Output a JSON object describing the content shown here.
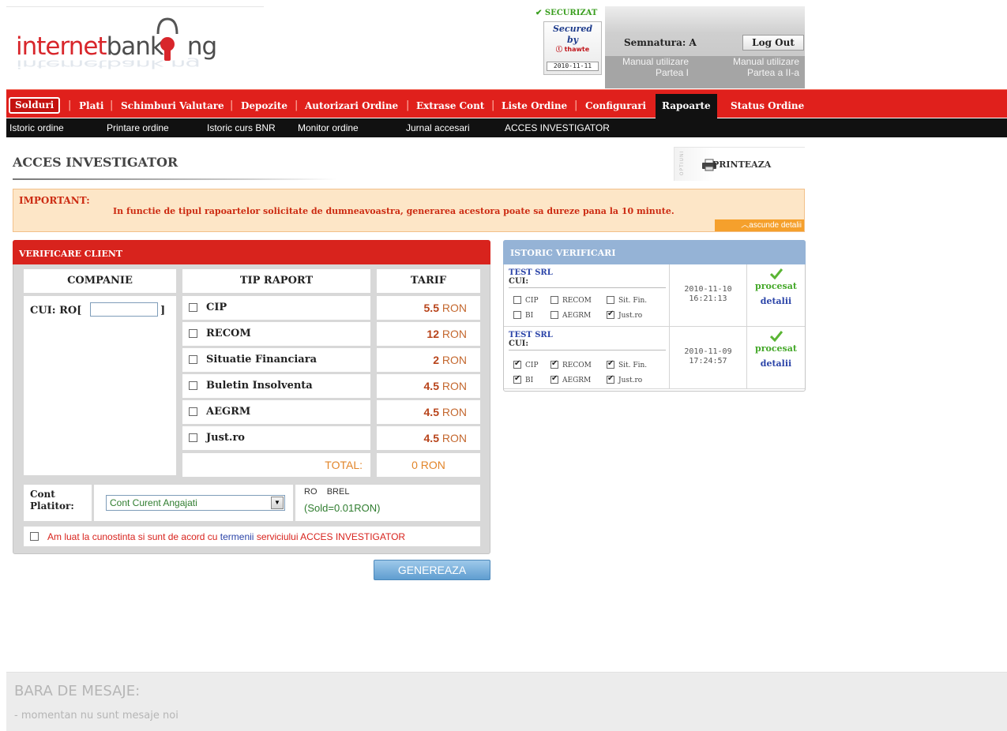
{
  "logo": {
    "word1": "internet",
    "word2": "bank",
    "word3": "ng"
  },
  "security": {
    "securizat": "SECURIZAT",
    "seal_line1": "Secured",
    "seal_line2": "by",
    "seal_brand": "thawte",
    "seal_date": "2010-11-11"
  },
  "user": {
    "semnatura": "Semnatura: A",
    "logout": "Log Out",
    "manual1_l1": "Manual utilizare",
    "manual1_l2": "Partea I",
    "manual2_l1": "Manual utilizare",
    "manual2_l2": "Partea a II-a"
  },
  "main_menu": [
    {
      "label": "Solduri"
    },
    {
      "label": "Plati"
    },
    {
      "label": "Schimburi Valutare"
    },
    {
      "label": "Depozite"
    },
    {
      "label": "Autorizari Ordine"
    },
    {
      "label": "Extrase Cont"
    },
    {
      "label": "Liste Ordine"
    },
    {
      "label": "Configurari"
    },
    {
      "label": "Rapoarte"
    },
    {
      "label": "Status Ordine"
    }
  ],
  "sub_menu": [
    {
      "label": "Istoric ordine"
    },
    {
      "label": "Printare ordine"
    },
    {
      "label": "Istoric curs BNR"
    },
    {
      "label": "Monitor ordine"
    },
    {
      "label": "Jurnal accesari"
    },
    {
      "label": "ACCES INVESTIGATOR"
    }
  ],
  "page": {
    "title": "ACCES INVESTIGATOR",
    "optiuni": "OPTIUNI",
    "print": "PRINTEAZA"
  },
  "important": {
    "label": "IMPORTANT:",
    "text": "In functie de tipul rapoartelor solicitate de dumneavoastra, generarea acestora poate sa dureze pana la 10 minute.",
    "hide": "ascunde detalii"
  },
  "verificare": {
    "title": "VERIFICARE CLIENT",
    "headers": {
      "companie": "COMPANIE",
      "tip": "TIP RAPORT",
      "tarif": "TARIF"
    },
    "cui_label": "CUI: RO[",
    "cui_close": "]",
    "cui_value": "",
    "reports": [
      {
        "name": "CIP",
        "price": "5.5",
        "currency": "RON"
      },
      {
        "name": "RECOM",
        "price": "12",
        "currency": "RON"
      },
      {
        "name": "Situatie Financiara",
        "price": "2",
        "currency": "RON"
      },
      {
        "name": "Buletin Insolventa",
        "price": "4.5",
        "currency": "RON"
      },
      {
        "name": "AEGRM",
        "price": "4.5",
        "currency": "RON"
      },
      {
        "name": "Just.ro",
        "price": "4.5",
        "currency": "RON"
      }
    ],
    "total_label": "TOTAL:",
    "total_value": "0 RON",
    "cont_label_l1": "Cont",
    "cont_label_l2": "Platitor:",
    "cont_selected": "Cont Curent Angajati",
    "cont_iban": "RO    BREL",
    "cont_sold": "(Sold=0.01RON)",
    "termeni_before": "Am luat la cunostinta si sunt de acord cu ",
    "termeni_link": "termenii",
    "termeni_after": " serviciului ACCES INVESTIGATOR",
    "genereaza": "GENEREAZA"
  },
  "istoric": {
    "title": "ISTORIC VERIFICARI",
    "rows": [
      {
        "company": "TEST SRL",
        "cui": "CUI:",
        "opts": [
          {
            "label": "CIP",
            "on": false
          },
          {
            "label": "RECOM",
            "on": false
          },
          {
            "label": "Sit. Fin.",
            "on": false
          },
          {
            "label": "BI",
            "on": false
          },
          {
            "label": "AEGRM",
            "on": false
          },
          {
            "label": "Just.ro",
            "on": true
          }
        ],
        "date": "2010-11-10",
        "time": "16:21:13",
        "status": "procesat",
        "detalii": "detalii"
      },
      {
        "company": "TEST SRL",
        "cui": "CUI:",
        "opts": [
          {
            "label": "CIP",
            "on": true
          },
          {
            "label": "RECOM",
            "on": true
          },
          {
            "label": "Sit. Fin.",
            "on": true
          },
          {
            "label": "BI",
            "on": true
          },
          {
            "label": "AEGRM",
            "on": true
          },
          {
            "label": "Just.ro",
            "on": true
          }
        ],
        "date": "2010-11-09",
        "time": "17:24:57",
        "status": "procesat",
        "detalii": "detalii"
      }
    ]
  },
  "mesaje": {
    "title": "BARA DE MESAJE:",
    "text": "- momentan nu sunt mesaje noi"
  },
  "colors": {
    "brand_red": "#e0201c",
    "accent_blue": "#95b3d6",
    "status_green": "#45a82a"
  }
}
